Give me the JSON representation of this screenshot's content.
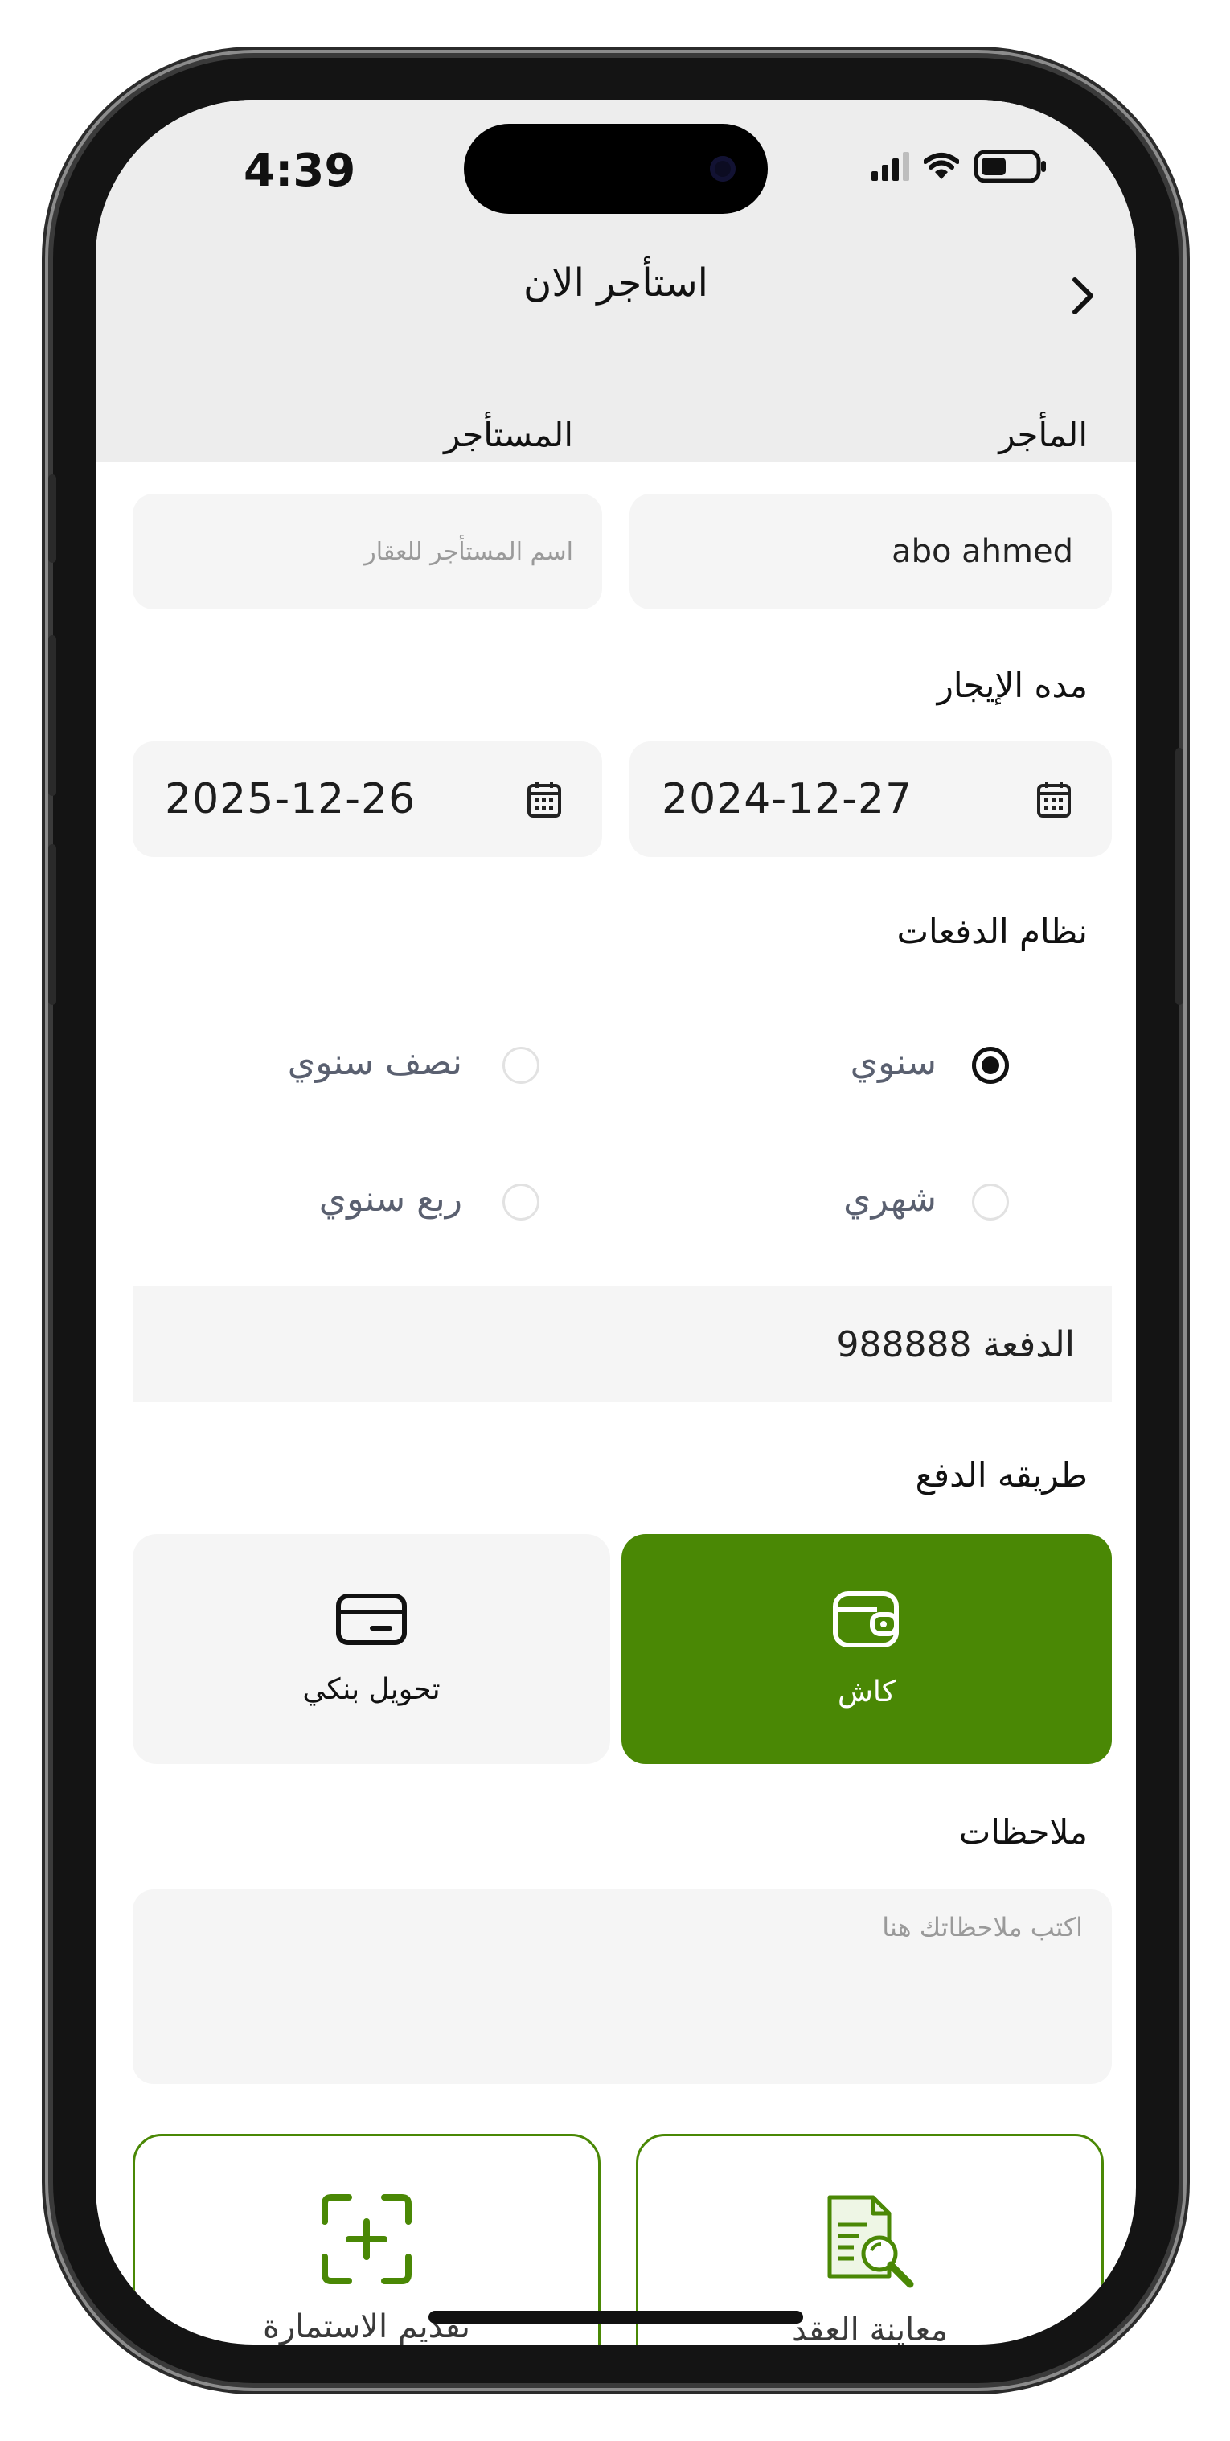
{
  "status_bar": {
    "time": "4:39"
  },
  "header": {
    "title": "استأجر الان"
  },
  "parties": {
    "landlord_label": "المأجر",
    "landlord_value": "abo ahmed",
    "tenant_label": "المستأجر",
    "tenant_placeholder": "اسم المستأجر للعقار"
  },
  "lease_period": {
    "label": "مده الإيجار",
    "start_date": "2024-12-27",
    "end_date": "2025-12-26"
  },
  "payment_system": {
    "label": "نظام الدفعات",
    "options": [
      {
        "label": "سنوي",
        "checked": true
      },
      {
        "label": "نصف سنوي",
        "checked": false
      },
      {
        "label": "شهري",
        "checked": false
      },
      {
        "label": "ربع سنوي",
        "checked": false
      }
    ]
  },
  "installment": {
    "text": "الدفعة 988888"
  },
  "payment_method": {
    "label": "طريقه الدفع",
    "options": [
      {
        "label": "كاش",
        "icon": "wallet-icon",
        "selected": true
      },
      {
        "label": "تحويل بنكي",
        "icon": "credit-card-icon",
        "selected": false
      }
    ]
  },
  "notes": {
    "label": "ملاحظات",
    "placeholder": "اكتب ملاحظاتك هنا"
  },
  "actions": [
    {
      "label": "معاينة العقد",
      "icon": "document-search-icon"
    },
    {
      "label": "تقديم الاستمارة",
      "icon": "add-scan-icon"
    }
  ],
  "colors": {
    "accent": "#4a8805",
    "header_bg": "#ededed",
    "field_bg": "#f5f5f5",
    "radio_label": "#5a6070"
  }
}
